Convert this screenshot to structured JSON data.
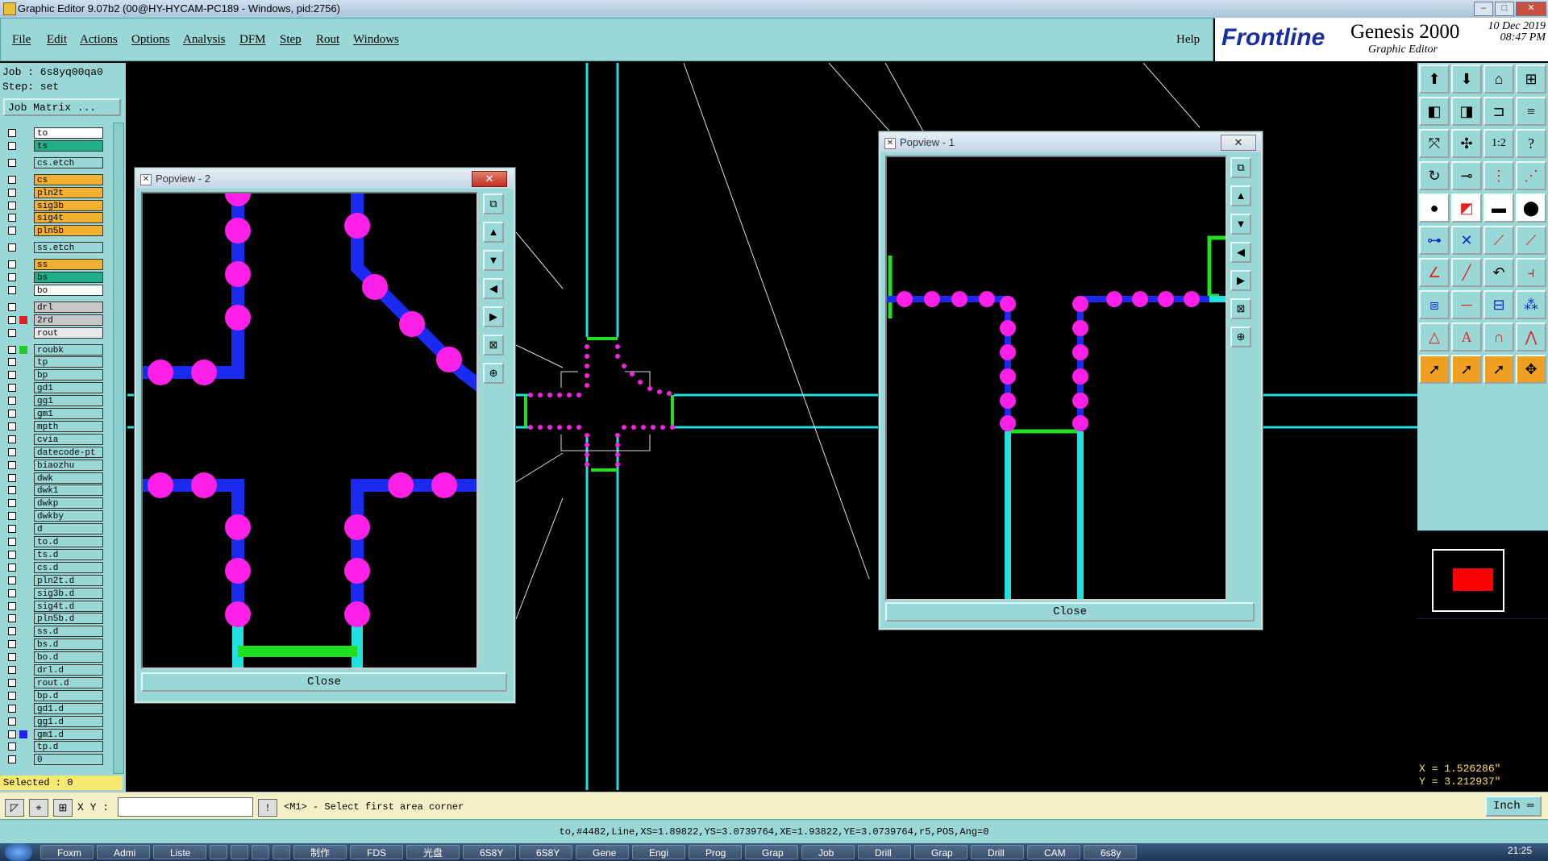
{
  "window": {
    "title": "Graphic Editor 9.07b2 (00@HY-HYCAM-PC189 - Windows, pid:2756)",
    "controls": [
      "–",
      "□",
      "✕"
    ]
  },
  "menubar": {
    "items": [
      "File",
      "Edit",
      "Actions",
      "Options",
      "Analysis",
      "DFM",
      "Step",
      "Rout",
      "Windows"
    ],
    "help": "Help"
  },
  "brand": {
    "logo": "Frontline",
    "product": "Genesis 2000",
    "subtitle": "Graphic Editor",
    "date_line1": "10  Dec  2019",
    "date_line2": "08:47  PM"
  },
  "job": {
    "job_line": "Job : 6s8yq00qa0",
    "step_line": "Step: set",
    "matrix_button": "Job Matrix ..."
  },
  "layers": [
    {
      "name": "to",
      "bg": "#ffffff"
    },
    {
      "name": "ts",
      "bg": "#1fb08a"
    },
    {
      "name": "cs.etch",
      "bg": "#9ad8d8"
    },
    {
      "name": "cs",
      "bg": "#f0b030"
    },
    {
      "name": "pln2t",
      "bg": "#f0b030"
    },
    {
      "name": "sig3b",
      "bg": "#f0b030"
    },
    {
      "name": "sig4t",
      "bg": "#f0b030"
    },
    {
      "name": "pln5b",
      "bg": "#f0b030"
    },
    {
      "name": "ss.etch",
      "bg": "#9ad8d8"
    },
    {
      "name": "ss",
      "bg": "#f0b030"
    },
    {
      "name": "bs",
      "bg": "#1fb08a"
    },
    {
      "name": "bo",
      "bg": "#ffffff"
    },
    {
      "name": "drl",
      "bg": "#c8c8c8"
    },
    {
      "name": "2rd",
      "bg": "#c8c8c8",
      "swatch": "#e02020"
    },
    {
      "name": "rout",
      "bg": "#e8e8e8"
    },
    {
      "name": "roubk",
      "bg": "#9ad8d8",
      "swatch": "#20d020"
    },
    {
      "name": "tp",
      "bg": "#9ad8d8"
    },
    {
      "name": "bp",
      "bg": "#9ad8d8"
    },
    {
      "name": "gd1",
      "bg": "#9ad8d8"
    },
    {
      "name": "gg1",
      "bg": "#9ad8d8"
    },
    {
      "name": "gm1",
      "bg": "#9ad8d8"
    },
    {
      "name": "mpth",
      "bg": "#9ad8d8"
    },
    {
      "name": "cvia",
      "bg": "#9ad8d8"
    },
    {
      "name": "datecode-pt",
      "bg": "#9ad8d8"
    },
    {
      "name": "biaozhu",
      "bg": "#9ad8d8"
    },
    {
      "name": "dwk",
      "bg": "#9ad8d8"
    },
    {
      "name": "dwk1",
      "bg": "#9ad8d8"
    },
    {
      "name": "dwkp",
      "bg": "#9ad8d8"
    },
    {
      "name": "dwkby",
      "bg": "#9ad8d8"
    },
    {
      "name": "d",
      "bg": "#9ad8d8"
    },
    {
      "name": "to.d",
      "bg": "#9ad8d8"
    },
    {
      "name": "ts.d",
      "bg": "#9ad8d8"
    },
    {
      "name": "cs.d",
      "bg": "#9ad8d8"
    },
    {
      "name": "pln2t.d",
      "bg": "#9ad8d8"
    },
    {
      "name": "sig3b.d",
      "bg": "#9ad8d8"
    },
    {
      "name": "sig4t.d",
      "bg": "#9ad8d8"
    },
    {
      "name": "pln5b.d",
      "bg": "#9ad8d8"
    },
    {
      "name": "ss.d",
      "bg": "#9ad8d8"
    },
    {
      "name": "bs.d",
      "bg": "#9ad8d8"
    },
    {
      "name": "bo.d",
      "bg": "#9ad8d8"
    },
    {
      "name": "drl.d",
      "bg": "#9ad8d8"
    },
    {
      "name": "rout.d",
      "bg": "#9ad8d8"
    },
    {
      "name": "bp.d",
      "bg": "#9ad8d8"
    },
    {
      "name": "gd1.d",
      "bg": "#9ad8d8"
    },
    {
      "name": "gg1.d",
      "bg": "#9ad8d8"
    },
    {
      "name": "gm1.d",
      "bg": "#9ad8d8",
      "swatch": "#2020f0"
    },
    {
      "name": "tp.d",
      "bg": "#9ad8d8"
    },
    {
      "name": "0",
      "bg": "#9ad8d8"
    }
  ],
  "selected": "Selected : 0",
  "popview2": {
    "title": "Popview - 2",
    "close": "Close",
    "close_x": "✕"
  },
  "popview1": {
    "title": "Popview - 1",
    "close": "Close",
    "close_x": "✕"
  },
  "coords": {
    "x": "X = 1.526286\"",
    "y": "Y = 3.212937\""
  },
  "bottombar": {
    "xy_label": "X Y :",
    "xy_value": "",
    "prompt": "<M1> - Select first area corner",
    "unit": "Inch ═"
  },
  "status": "to,#4482,Line,XS=1.89822,YS=3.0739764,XE=1.93822,YE=3.0739764,r5,POS,Ang=0",
  "taskbar": {
    "items": [
      "Foxm",
      "Admi",
      "Liste",
      "",
      "",
      "",
      "",
      "制作",
      "FDS",
      "光盘",
      "6S8Y",
      "6S8Y",
      "Gene",
      "Engi",
      "Prog",
      "Grap",
      "Job",
      "Drill",
      "Grap",
      "Drill",
      "CAM",
      "6s8y"
    ],
    "clock": "21:25"
  },
  "colors": {
    "accent": "#9ad8d8",
    "trace": "#1a2af0",
    "pad": "#ff20e8",
    "outline": "#20e0e0",
    "rout": "#20e020"
  }
}
